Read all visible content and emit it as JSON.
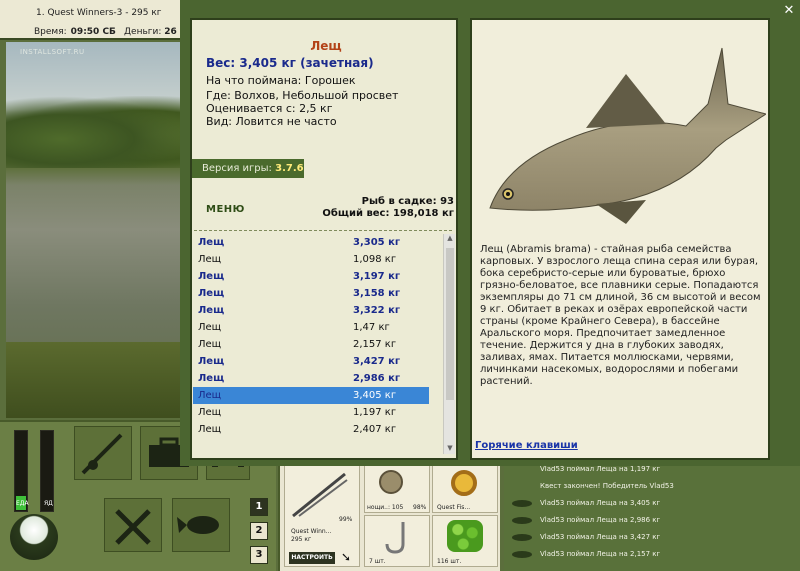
{
  "top_bar": {
    "quest_line": "1. Quest Winners-3 - 295 кг",
    "time_label": "Время:",
    "time_value": "09:50 СБ",
    "money_label": "Деньги:",
    "money_value": "26"
  },
  "scene": {
    "watermark": "INSTALLSOFT.RU"
  },
  "controls": {
    "meter_food_label": "ЕДА",
    "meter_bait_label": "ЯД",
    "food_level": 0.18,
    "bait_level": 0.0,
    "pages": [
      "1",
      "2",
      "3"
    ],
    "active_page": "1"
  },
  "inventory": {
    "rod_percent": "99%",
    "rod_name": "Quest Winn...",
    "rod_weight": "295 кг",
    "setup_button": "НАСТРОИТЬ",
    "reel_label": "нощи..: 105",
    "reel_percent": "98%",
    "line_label": "Quest Fis...",
    "hooks_count": "7 шт.",
    "bait_count": "116 шт."
  },
  "chat": {
    "lines": [
      {
        "text": "Vlad53 поймал Леща на 1,197 кг",
        "icon": false
      },
      {
        "text": "Квест закончен! Победитель Vlad53",
        "icon": false
      },
      {
        "text": "Vlad53 поймал Леща на 3,405 кг",
        "icon": true
      },
      {
        "text": "Vlad53 поймал Леща на 2,986 кг",
        "icon": true
      },
      {
        "text": "Vlad53 поймал Леща на 3,427 кг",
        "icon": true
      },
      {
        "text": "Vlad53 поймал Леща на 2,157 кг",
        "icon": true
      }
    ]
  },
  "dialog": {
    "close_glyph": "✕",
    "fish_title": "Лещ",
    "weight_line": "Вес: 3,405 кг (зачетная)",
    "caught_on": "На что поймана: Горошек",
    "where": "Где: Волхов, Небольшой просвет",
    "valued_from": "Оценивается с: 2,5 кг",
    "kind": "Вид: Ловится не часто",
    "version_label": "Версия игры:",
    "version_value": "3.7.6",
    "menu_button": "МЕНЮ",
    "fish_in_keepnet": "Рыб в садке: 93",
    "total_weight": "Общий вес: 198,018 кг",
    "catch_list": [
      {
        "name": "Лещ",
        "weight": "3,305 кг",
        "highlight": true
      },
      {
        "name": "Лещ",
        "weight": "1,098 кг",
        "highlight": false
      },
      {
        "name": "Лещ",
        "weight": "3,197 кг",
        "highlight": true
      },
      {
        "name": "Лещ",
        "weight": "3,158 кг",
        "highlight": true
      },
      {
        "name": "Лещ",
        "weight": "3,322 кг",
        "highlight": true
      },
      {
        "name": "Лещ",
        "weight": "1,47 кг",
        "highlight": false
      },
      {
        "name": "Лещ",
        "weight": "2,157 кг",
        "highlight": false
      },
      {
        "name": "Лещ",
        "weight": "3,427 кг",
        "highlight": true
      },
      {
        "name": "Лещ",
        "weight": "2,986 кг",
        "highlight": true
      },
      {
        "name": "Лещ",
        "weight": "3,405 кг",
        "highlight": true,
        "selected": true
      },
      {
        "name": "Лещ",
        "weight": "1,197 кг",
        "highlight": false
      },
      {
        "name": "Лещ",
        "weight": "2,407 кг",
        "highlight": false
      }
    ],
    "description": "Лещ (Abramis brama) - стайная рыба семейства карповых. У взрослого леща спина серая или бурая, бока серебристо-серые или буроватые, брюхо грязно-беловатое, все плавники серые. Попадаются экземпляры до 71 см длиной, 36 см высотой и весом 9 кг. Обитает в реках и озёрах европейской части страны (кроме Крайнего Севера), в бассейне Аральского моря. Предпочитает замедленное течение. Держится у дна в глубоких заводях, заливах, ямах. Питается моллюсками, червями, личинками насекомых, водорослями и побегами растений.",
    "hotkeys_link": "Горячие клавиши"
  },
  "colors": {
    "frame_green": "#4b6530",
    "panel_cream": "#ecebd5",
    "title_orange": "#b34318",
    "highlight_blue": "#1a2a8c",
    "selection_blue": "#3a86d6",
    "link_blue": "#1a35a8"
  }
}
